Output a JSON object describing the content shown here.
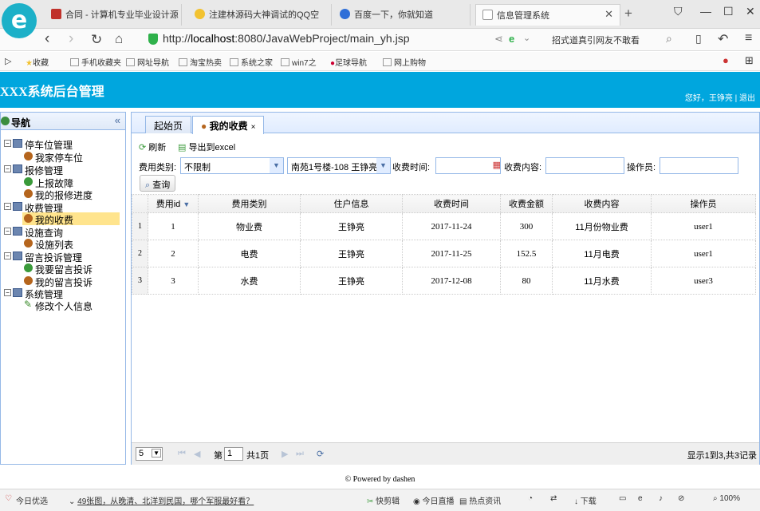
{
  "browser": {
    "logo": "e",
    "tabs": [
      {
        "label": "合同 - 计算机专业毕业设计源",
        "color": "#c0312b"
      },
      {
        "label": "注建林源码大神调试的QQ空",
        "color": "#f2c230"
      },
      {
        "label": "百度一下，你就知道",
        "color": "#2f6fd8"
      },
      {
        "label": "信息管理系统",
        "color": "#bbbbbb"
      }
    ],
    "new_tab": "+",
    "url_prefix": "http://",
    "url_host": "localhost",
    "url_rest": ":8080/JavaWebProject/main_yh.jsp",
    "news_text": "招式道真引网友不敢看",
    "bookmarks": [
      "收藏",
      "手机收藏夹",
      "网址导航",
      "淘宝热卖",
      "系统之家",
      "win7之",
      "足球导航",
      "网上购物"
    ]
  },
  "header": {
    "title": "XXX系统后台管理",
    "greeting": "您好，王铮亮 | 退出"
  },
  "sidebar": {
    "title": "导航",
    "collapse": "«",
    "groups": [
      {
        "label": "停车位管理",
        "items": [
          "我家停车位"
        ]
      },
      {
        "label": "报修管理",
        "items": [
          "上报故障",
          "我的报修进度"
        ]
      },
      {
        "label": "收费管理",
        "items": [
          "我的收费"
        ]
      },
      {
        "label": "设施查询",
        "items": [
          "设施列表"
        ]
      },
      {
        "label": "留言投诉管理",
        "items": [
          "我要留言投诉",
          "我的留言投诉"
        ]
      },
      {
        "label": "系统管理",
        "items": [
          "修改个人信息"
        ]
      }
    ]
  },
  "main": {
    "tabs": [
      "起始页",
      "我的收费"
    ],
    "toolbar": {
      "refresh": "刷新",
      "export": "导出到excel"
    },
    "filters": {
      "fee_type_label": "费用类别:",
      "fee_type_value": "不限制",
      "resident_value": "南苑1号楼-108 王铮亮",
      "fee_time_label": "收费时间:",
      "fee_content_label": "收费内容:",
      "operator_label": "操作员:",
      "search": "查询"
    },
    "grid": {
      "columns": [
        "费用id",
        "费用类别",
        "住户信息",
        "收费时间",
        "收费金额",
        "收费内容",
        "操作员"
      ],
      "rows": [
        {
          "rn": "1",
          "id": "1",
          "type": "物业费",
          "resident": "王铮亮",
          "time": "2017-11-24",
          "amount": "300",
          "content": "11月份物业费",
          "operator": "user1"
        },
        {
          "rn": "2",
          "id": "2",
          "type": "电费",
          "resident": "王铮亮",
          "time": "2017-11-25",
          "amount": "152.5",
          "content": "11月电费",
          "operator": "user1"
        },
        {
          "rn": "3",
          "id": "3",
          "type": "水费",
          "resident": "王铮亮",
          "time": "2017-12-08",
          "amount": "80",
          "content": "11月水费",
          "operator": "user3"
        }
      ]
    },
    "pager": {
      "page_size": "5",
      "page_prefix": "第",
      "page_value": "1",
      "page_suffix": "共1页",
      "info": "显示1到3,共3记录"
    }
  },
  "footer": "© Powered by dashen",
  "statusbar": {
    "left": "今日优选",
    "headline": "49张图，从晚清、北洋到民国，哪个军服最好看？",
    "items": [
      "快剪辑",
      "今日直播",
      "热点资讯",
      "下载"
    ],
    "zoom": "100%"
  }
}
